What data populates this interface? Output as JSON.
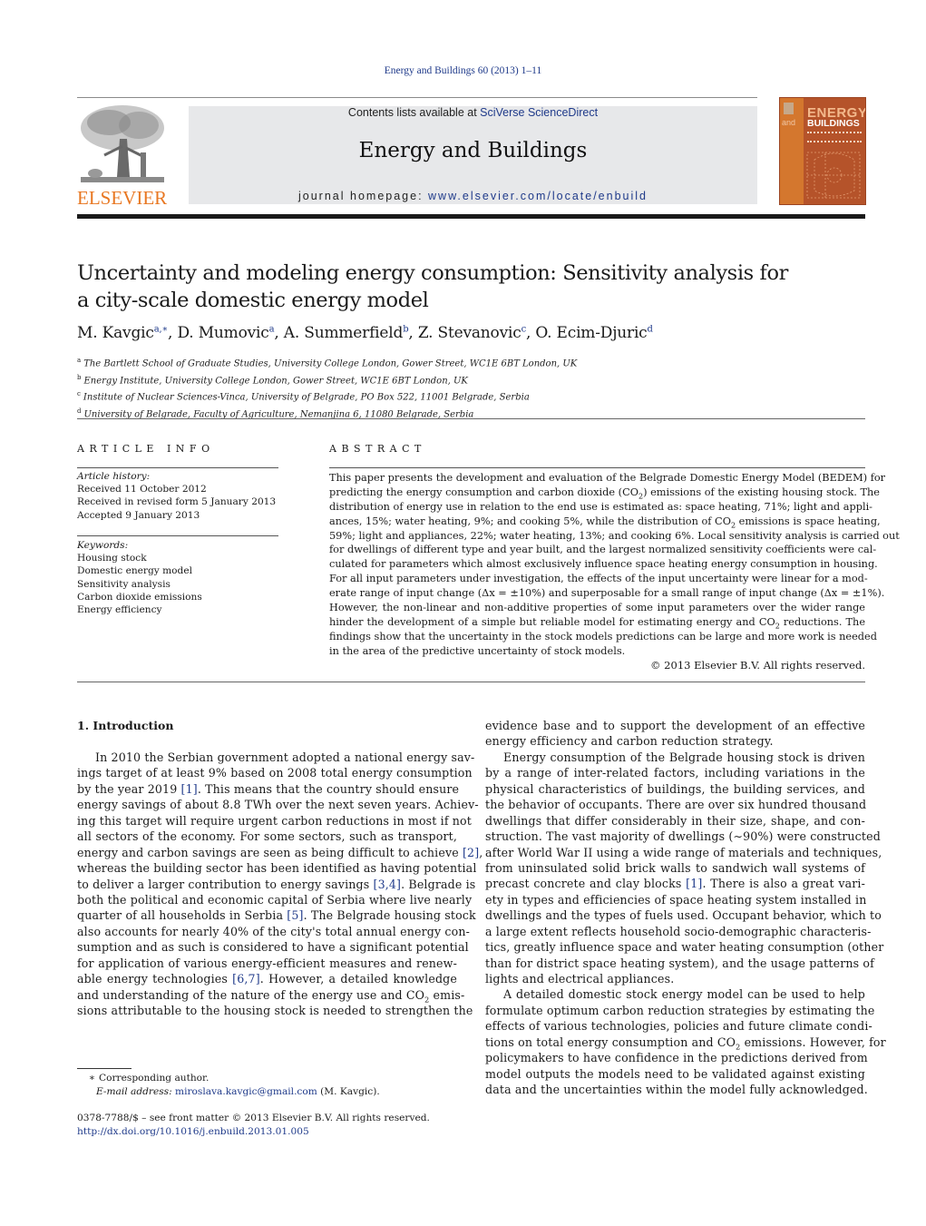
{
  "header": {
    "citation": "Energy and Buildings 60 (2013) 1–11",
    "contents_prefix": "Contents lists available at ",
    "contents_link": "SciVerse ScienceDirect",
    "journal_name": "Energy and Buildings",
    "homepage_prefix": "journal homepage: ",
    "homepage_link": "www.elsevier.com/locate/enbuild",
    "publisher_logo_text": "ELSEVIER",
    "cover": {
      "title_line1": "ENERGY",
      "title_and": "and",
      "title_line2": "BUILDINGS"
    },
    "colors": {
      "publisher_orange": "#e87722",
      "link_blue": "#1f3a8a",
      "banner_gray": "#e7e8ea",
      "cover_rust": "#b5532a"
    }
  },
  "article": {
    "title_lines": [
      "Uncertainty and modeling energy consumption: Sensitivity analysis for",
      "a city-scale domestic energy model"
    ],
    "authors": [
      {
        "name": "M. Kavgic",
        "sup": "a,∗"
      },
      {
        "name": "D. Mumovic",
        "sup": "a"
      },
      {
        "name": "A. Summerfield",
        "sup": "b"
      },
      {
        "name": "Z. Stevanovic",
        "sup": "c"
      },
      {
        "name": "O. Ecim-Djuric",
        "sup": "d"
      }
    ],
    "affiliations": [
      {
        "key": "a",
        "text": "The Bartlett School of Graduate Studies, University College London, Gower Street, WC1E 6BT London, UK"
      },
      {
        "key": "b",
        "text": "Energy Institute, University College London, Gower Street, WC1E 6BT London, UK"
      },
      {
        "key": "c",
        "text": "Institute of Nuclear Sciences-Vinca, University of Belgrade, PO Box 522, 11001 Belgrade, Serbia"
      },
      {
        "key": "d",
        "text": "University of Belgrade, Faculty of Agriculture, Nemanjina 6, 11080 Belgrade, Serbia"
      }
    ]
  },
  "article_info": {
    "heading": "ARTICLE INFO",
    "history_label": "Article history:",
    "history": [
      "Received 11 October 2012",
      "Received in revised form 5 January 2013",
      "Accepted 9 January 2013"
    ],
    "keywords_label": "Keywords:",
    "keywords": [
      "Housing stock",
      "Domestic energy model",
      "Sensitivity analysis",
      "Carbon dioxide emissions",
      "Energy efficiency"
    ]
  },
  "abstract": {
    "heading": "ABSTRACT",
    "lines": [
      "This paper presents the development and evaluation of the Belgrade Domestic Energy Model (BEDEM) for",
      "predicting the energy consumption and carbon dioxide (CO₂) emissions of the existing housing stock. The",
      "distribution of energy use in relation to the end use is estimated as: space heating, 71%; light and appli-",
      "ances, 15%; water heating, 9%; and cooking 5%, while the distribution of CO₂ emissions is space heating,",
      "59%; light and appliances, 22%; water heating, 13%; and cooking 6%. Local sensitivity analysis is carried out",
      "for dwellings of different type and year built, and the largest normalized sensitivity coefficients were cal-",
      "culated for parameters which almost exclusively influence space heating energy consumption in housing.",
      "For all input parameters under investigation, the effects of the input uncertainty were linear for a mod-",
      "erate range of input change (Δx = ±10%) and superposable for a small range of input change (Δx = ±1%).",
      "However, the non-linear and non-additive properties of some input parameters over the wider range",
      "hinder the development of a simple but reliable model for estimating energy and CO₂ reductions. The",
      "findings show that the uncertainty in the stock models predictions can be large and more work is needed",
      "in the area of the predictive uncertainty of stock models."
    ],
    "copyright": "© 2013 Elsevier B.V. All rights reserved."
  },
  "body": {
    "section_heading": "1.  Introduction",
    "left_column_lines": [
      "In 2010 the Serbian government adopted a national energy sav-",
      "ings target of at least 9% based on 2008 total energy consumption",
      "by the year 2019 [1]. This means that the country should ensure",
      "energy savings of about 8.8 TWh over the next seven years. Achiev-",
      "ing this target will require urgent carbon reductions in most if not",
      "all sectors of the economy. For some sectors, such as transport,",
      "energy and carbon savings are seen as being difficult to achieve [2],",
      "whereas the building sector has been identified as having potential",
      "to deliver a larger contribution to energy savings [3,4]. Belgrade is",
      "both the political and economic capital of Serbia where live nearly",
      "quarter of all households in Serbia [5]. The Belgrade housing stock",
      "also accounts for nearly 40% of the city's total annual energy con-",
      "sumption and as such is considered to have a significant potential",
      "for application of various energy-efficient measures and renew-",
      "able energy technologies [6,7]. However, a detailed knowledge",
      "and understanding of the nature of the energy use and CO₂ emis-",
      "sions attributable to the housing stock is needed to strengthen the"
    ],
    "right_column_lines": [
      "evidence base and to support the development of an effective",
      "energy efficiency and carbon reduction strategy.",
      "Energy consumption of the Belgrade housing stock is driven",
      "by a range of inter-related factors, including variations in the",
      "physical characteristics of buildings, the building services, and",
      "the behavior of occupants. There are over six hundred thousand",
      "dwellings that differ considerably in their size, shape, and con-",
      "struction. The vast majority of dwellings (∼90%) were constructed",
      "after World War II using a wide range of materials and techniques,",
      "from uninsulated solid brick walls to sandwich wall systems of",
      "precast concrete and clay blocks [1]. There is also a great vari-",
      "ety in types and efficiencies of space heating system installed in",
      "dwellings and the types of fuels used. Occupant behavior, which to",
      "a large extent reflects household socio-demographic characteris-",
      "tics, greatly influence space and water heating consumption (other",
      "than for district space heating system), and the usage patterns of",
      "lights and electrical appliances.",
      "A detailed domestic stock energy model can be used to help",
      "formulate optimum carbon reduction strategies by estimating the",
      "effects of various technologies, policies and future climate condi-",
      "tions on total energy consumption and CO₂ emissions. However, for",
      "policymakers to have confidence in the predictions derived from",
      "model outputs the models need to be validated against existing",
      "data and the uncertainties within the model fully acknowledged."
    ]
  },
  "footnotes": {
    "corresponding_marker": "∗",
    "corresponding_text": "Corresponding author.",
    "email_label": "E-mail address:",
    "email": "miroslava.kavgic@gmail.com",
    "email_owner": " (M. Kavgic).",
    "issn_line": "0378-7788/$ – see front matter © 2013 Elsevier B.V. All rights reserved.",
    "doi": "http://dx.doi.org/10.1016/j.enbuild.2013.01.005"
  }
}
